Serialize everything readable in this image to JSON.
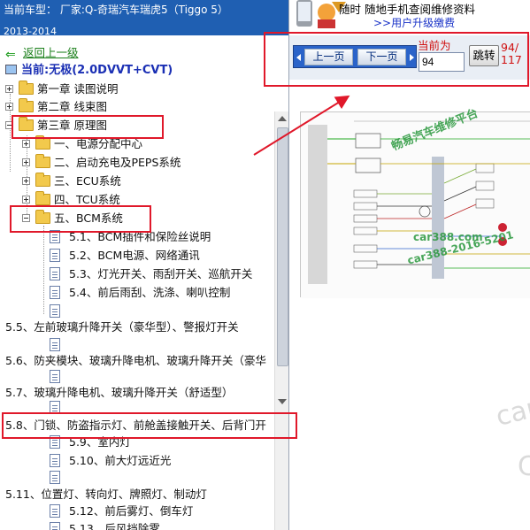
{
  "header": {
    "car_model": "当前车型：  厂家:Q-奇瑞汽车瑞虎5（Tiggo 5）",
    "year": "2013-2014"
  },
  "tree": {
    "back_label": "返回上一级",
    "current_label": "当前:无极(2.0DVVT+CVT)",
    "chapter1": "第一章 读图说明",
    "chapter2": "第二章 线束图",
    "chapter3": "第三章 原理图",
    "sec1": "一、电源分配中心",
    "sec2": "二、启动充电及PEPS系统",
    "sec3": "三、ECU系统",
    "sec4": "四、TCU系统",
    "sec5": "五、BCM系统",
    "items": [
      "5.1、BCM插件和保险丝说明",
      "5.2、BCM电源、网络通讯",
      "5.3、灯光开关、雨刮开关、巡航开关",
      "5.4、前后雨刮、洗涤、喇叭控制",
      "5.5、左前玻璃升降开关（豪华型）、警报灯开关",
      "5.6、防夹模块、玻璃升降电机、玻璃升降开关（豪华",
      "5.7、玻璃升降电机、玻璃升降开关（舒适型）",
      "5.8、门锁、防盗指示灯、前舱盖接触开关、后背门开",
      "5.9、室内灯",
      "5.10、前大灯远近光",
      "5.11、位置灯、转向灯、牌照灯、制动灯",
      "5.12、前后雾灯、倒车灯",
      "5.13、后风挡除雾"
    ]
  },
  "banner": {
    "line1": "随时 随地手机查阅维修资料",
    "line2": ">>用户升级缴费"
  },
  "toolbar": {
    "prev_label": "上一页",
    "next_label": "下一页",
    "current_label": "当前为",
    "page_value": "94",
    "jump_label": "跳转",
    "page_current": "94/",
    "page_total": "117"
  },
  "document": {
    "watermark_platform": "畅易汽车维修平台",
    "watermark_site": "car388.com",
    "watermark_id": "car388-2016-5201",
    "bg_watermark1": "car3",
    "bg_watermark2": "C"
  },
  "colors": {
    "header_bg": "#1f5fb2",
    "annotation": "#e0182a",
    "link_green": "#1a7f1a",
    "current_blue": "#1a2fb4",
    "page_red": "#d01010"
  }
}
